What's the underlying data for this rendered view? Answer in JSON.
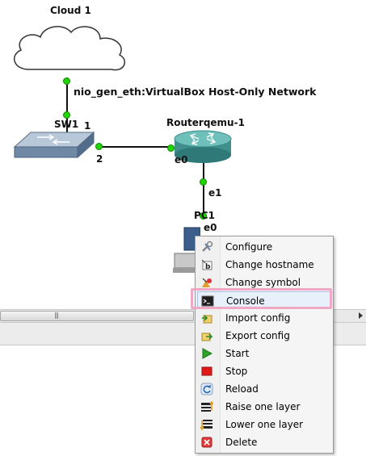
{
  "topology": {
    "cloud_label": "Cloud 1",
    "link_label": "nio_gen_eth:VirtualBox Host-Only Network",
    "switch_label": "SW1",
    "switch_port_top": "1",
    "switch_port_right": "2",
    "router_label": "Routerqemu-1",
    "router_port_left": "e0",
    "router_port_bottom": "e1",
    "pc_label": "PC1",
    "pc_port": "e0"
  },
  "scrollbar": {
    "grip": "|||"
  },
  "context_menu": {
    "items": [
      {
        "label": "Configure",
        "icon": "wrench-icon"
      },
      {
        "label": "Change hostname",
        "icon": "hostname-icon"
      },
      {
        "label": "Change symbol",
        "icon": "symbol-icon"
      },
      {
        "label": "Console",
        "icon": "console-icon"
      },
      {
        "label": "Import config",
        "icon": "import-icon"
      },
      {
        "label": "Export config",
        "icon": "export-icon"
      },
      {
        "label": "Start",
        "icon": "play-icon"
      },
      {
        "label": "Stop",
        "icon": "stop-icon"
      },
      {
        "label": "Reload",
        "icon": "reload-icon"
      },
      {
        "label": "Raise one layer",
        "icon": "raise-layer-icon"
      },
      {
        "label": "Lower one layer",
        "icon": "lower-layer-icon"
      },
      {
        "label": "Delete",
        "icon": "delete-icon"
      }
    ]
  }
}
